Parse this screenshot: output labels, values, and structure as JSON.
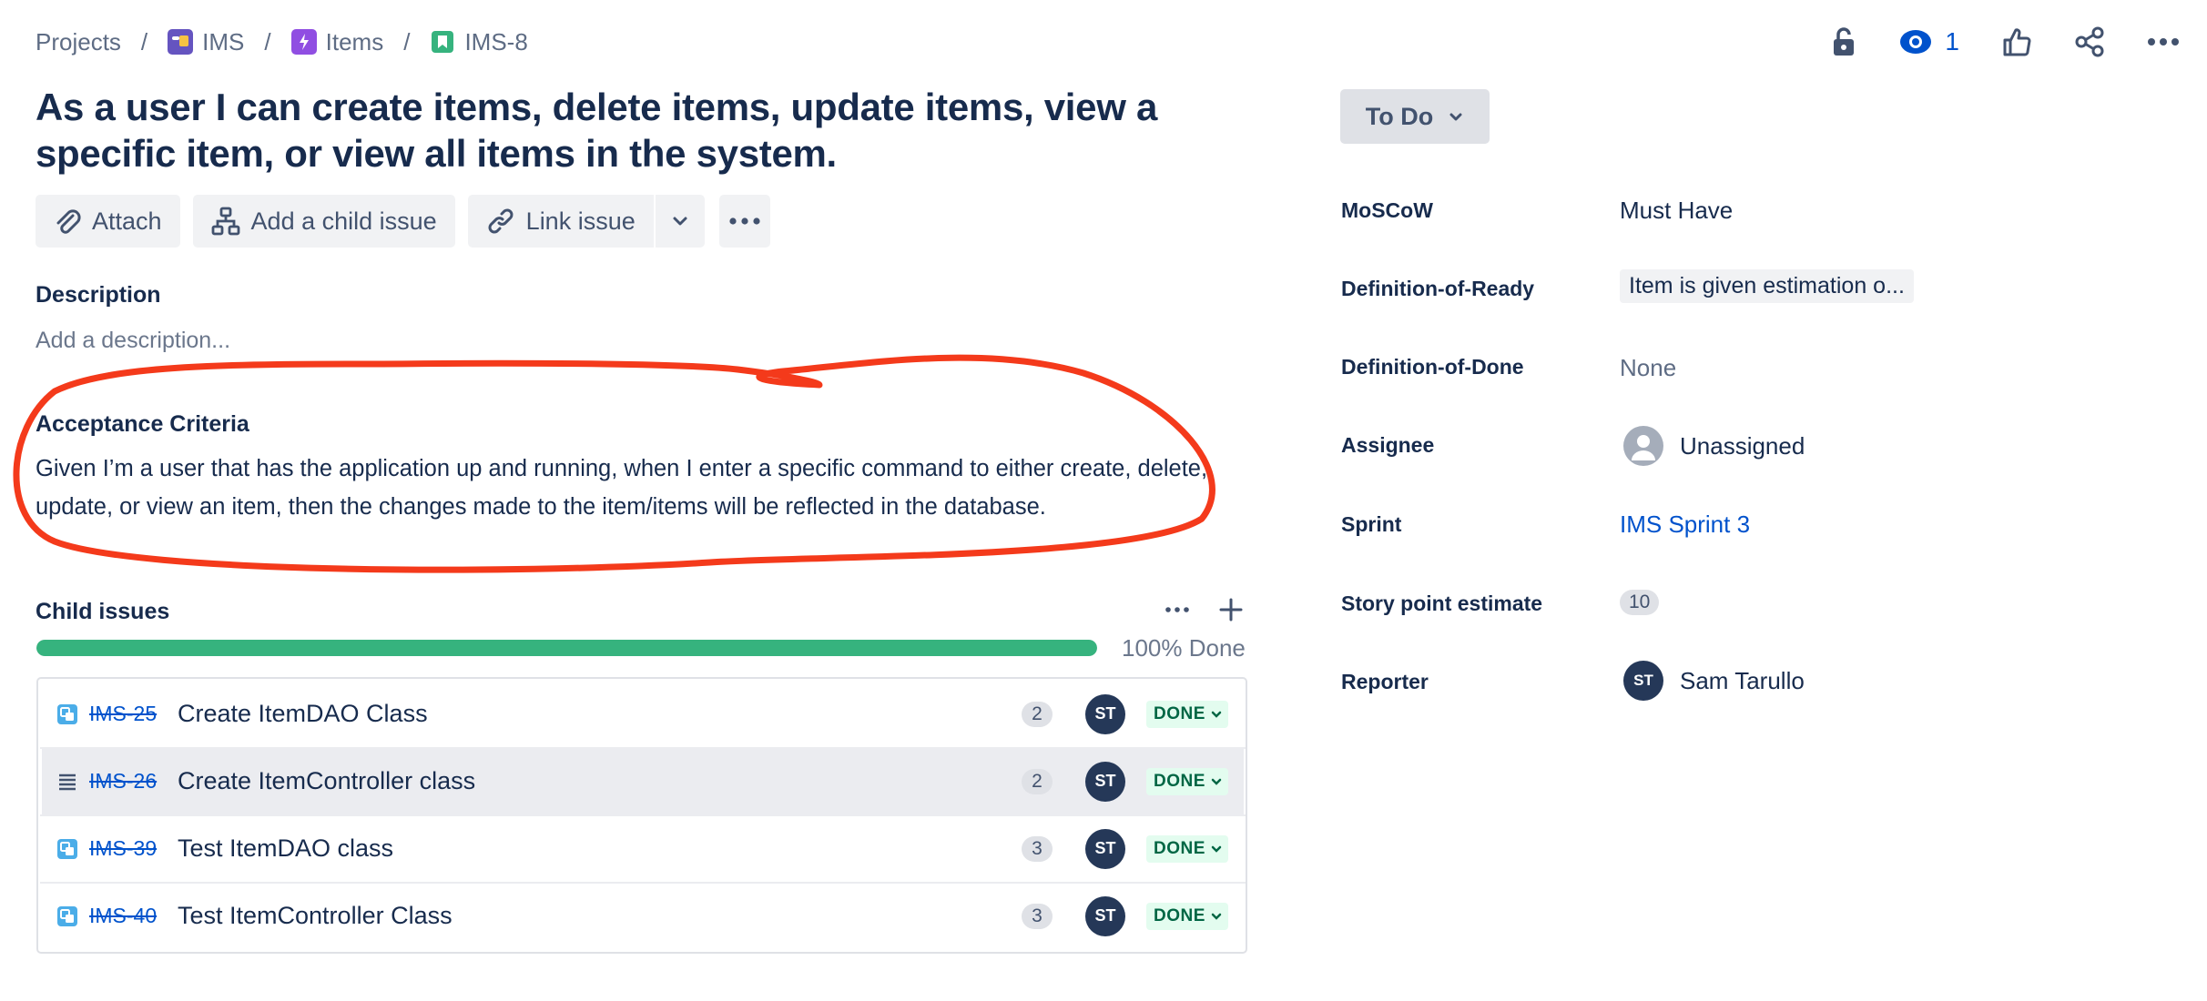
{
  "breadcrumb": {
    "projects": "Projects",
    "separator": "/",
    "project": "IMS",
    "epic": "Items",
    "issue_key": "IMS-8"
  },
  "header_actions": {
    "watch_count": "1",
    "icons": [
      "lock-icon",
      "eye-icon",
      "thumbs-up-icon",
      "share-icon",
      "more-icon"
    ]
  },
  "issue": {
    "title": "As a user I can create items, delete items, update items, view a specific item, or view all items in the system."
  },
  "toolbar": {
    "attach": "Attach",
    "add_child": "Add a child issue",
    "link_issue": "Link issue"
  },
  "description": {
    "label": "Description",
    "placeholder": "Add a description..."
  },
  "acceptance": {
    "label": "Acceptance Criteria",
    "text": "Given I’m a user that has the application up and running, when I enter a specific command to either create, delete, update, or view an item, then the changes made to the item/items will be reflected in the database."
  },
  "child_issues": {
    "label": "Child issues",
    "progress_percent": 100,
    "progress_label": "100% Done",
    "rows": [
      {
        "key": "IMS-25",
        "summary": "Create ItemDAO Class",
        "points": "2",
        "assignee": "ST",
        "status": "DONE",
        "type_icon": "subtask-icon"
      },
      {
        "key": "IMS-26",
        "summary": "Create ItemController class",
        "points": "2",
        "assignee": "ST",
        "status": "DONE",
        "type_icon": "drag-handle-icon"
      },
      {
        "key": "IMS-39",
        "summary": "Test ItemDAO class",
        "points": "3",
        "assignee": "ST",
        "status": "DONE",
        "type_icon": "subtask-icon"
      },
      {
        "key": "IMS-40",
        "summary": "Test ItemController Class",
        "points": "3",
        "assignee": "ST",
        "status": "DONE",
        "type_icon": "subtask-icon"
      }
    ]
  },
  "details": {
    "status": "To Do",
    "fields": {
      "moscow": {
        "label": "MoSCoW",
        "value": "Must Have"
      },
      "dor": {
        "label": "Definition-of-Ready",
        "value": "Item is given estimation o..."
      },
      "dod": {
        "label": "Definition-of-Done",
        "value": "None"
      },
      "assignee": {
        "label": "Assignee",
        "value": "Unassigned"
      },
      "sprint": {
        "label": "Sprint",
        "value": "IMS Sprint 3"
      },
      "story_points": {
        "label": "Story point estimate",
        "value": "10"
      },
      "reporter": {
        "label": "Reporter",
        "value": "Sam Tarullo",
        "initials": "ST"
      }
    }
  },
  "colors": {
    "annotation": "#f43a1b",
    "progress": "#36b37e",
    "link": "#0052cc",
    "done_bg": "#e3fcef",
    "done_text": "#006644"
  }
}
